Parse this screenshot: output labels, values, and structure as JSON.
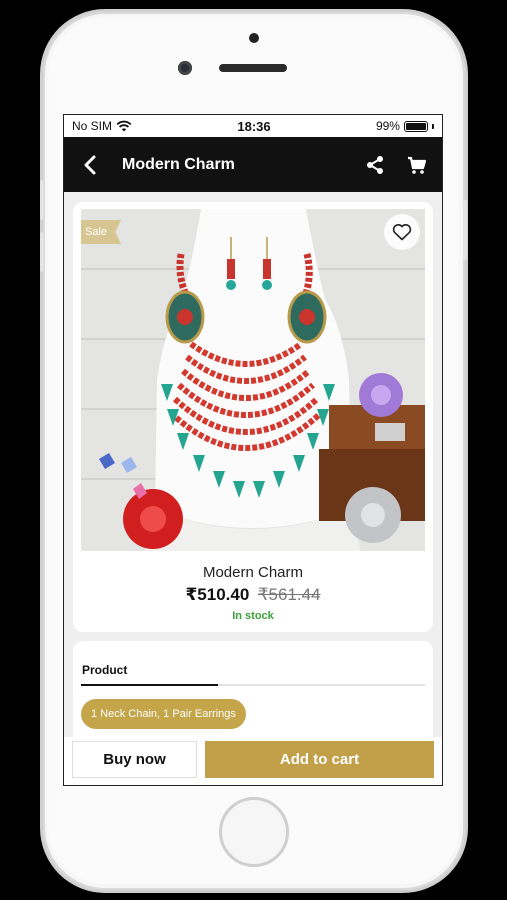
{
  "status_bar": {
    "carrier": "No SIM",
    "time": "18:36",
    "battery": "99%"
  },
  "app_bar": {
    "title": "Modern Charm",
    "back_icon": "chevron-left-icon",
    "share_icon": "share-icon",
    "cart_icon": "cart-icon"
  },
  "product": {
    "badge": "Sale",
    "name": "Modern Charm",
    "price": "₹510.40",
    "old_price": "₹561.44",
    "stock": "In stock",
    "image": "necklace-photo"
  },
  "details": {
    "tab_label": "Product",
    "variant": "1 Neck Chain, 1 Pair Earrings"
  },
  "actions": {
    "buy_now": "Buy now",
    "add_to_cart": "Add to cart"
  },
  "colors": {
    "accent": "#c2a04a",
    "header": "#111111",
    "in_stock": "#3aa13a",
    "sale_badge": "#d7c592"
  }
}
